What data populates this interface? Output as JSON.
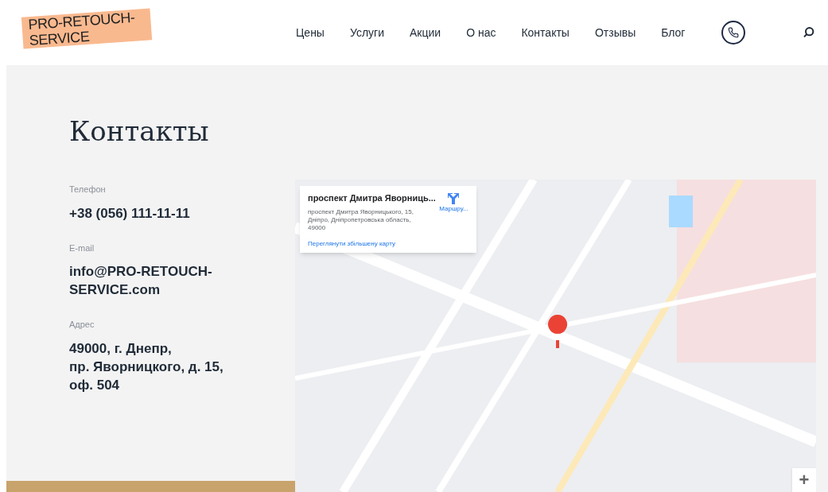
{
  "logo": {
    "text": "PRO-RETOUCH-SERVICE"
  },
  "nav": [
    {
      "label": "Цены"
    },
    {
      "label": "Услуги"
    },
    {
      "label": "Акции"
    },
    {
      "label": "О нас"
    },
    {
      "label": "Контакты"
    },
    {
      "label": "Отзывы"
    },
    {
      "label": "Блог"
    }
  ],
  "page": {
    "title": "Контакты"
  },
  "contacts": [
    {
      "label": "Телефон",
      "value": "+38 (056) 111-11-11"
    },
    {
      "label": "E-mail",
      "value": "info@PRO-RETOUCH-SERVICE.com"
    },
    {
      "label": "Адрес",
      "value": "49000, г. Днепр,\nпр. Яворницкого, д. 15,\nоф. 504"
    }
  ],
  "map_card": {
    "title": "проспект Дмитра Яворниць...",
    "address": "проспект Дмитра Яворницького, 15, Дніпро, Дніпропетровська область, 49000",
    "directions": "Маршру...",
    "larger_map_link": "Переглянути збільшену карту"
  },
  "zoom_in": "+"
}
